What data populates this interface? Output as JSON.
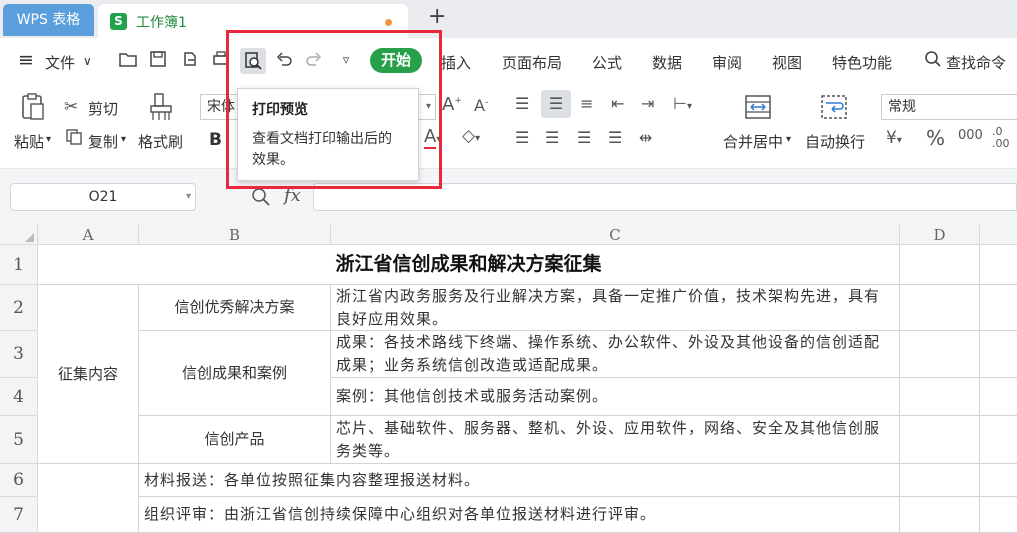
{
  "tabs": {
    "app": "WPS 表格",
    "doc_badge": "S",
    "doc": "工作簿1",
    "plus": "+"
  },
  "menu": {
    "hamburger": "≡",
    "file": "文件",
    "start": "开始",
    "items": [
      "插入",
      "页面布局",
      "公式",
      "数据",
      "审阅",
      "视图",
      "特色功能"
    ],
    "search": "查找命令"
  },
  "ribbon": {
    "paste": "粘贴",
    "cut": "剪切",
    "copy": "复制",
    "format_painter": "格式刷",
    "font": "宋体",
    "bold": "B",
    "merge": "合并居中",
    "wrap": "自动换行",
    "number_format": "常规"
  },
  "tooltip": {
    "title": "打印预览",
    "desc": "查看文档打印输出后的效果。"
  },
  "formula": {
    "cell_ref": "O21",
    "fx": "fx"
  },
  "grid": {
    "columns": [
      "A",
      "B",
      "C",
      "D"
    ],
    "rows": [
      "1",
      "2",
      "3",
      "4",
      "5",
      "6",
      "7"
    ],
    "title": "浙江省信创成果和解决方案征集",
    "a_merged": "征集内容",
    "b2": "信创优秀解决方案",
    "c2": "浙江省内政务服务及行业解决方案，具备一定推广价值，技术架构先进，具有良好应用效果。",
    "b34": "信创成果和案例",
    "c3": "成果：各技术路线下终端、操作系统、办公软件、外设及其他设备的信创适配成果；业务系统信创改造或适配成果。",
    "c4": "案例：其他信创技术或服务活动案例。",
    "b5": "信创产品",
    "c5": "芯片、基础软件、服务器、整机、外设、应用软件，网络、安全及其他信创服务类等。",
    "r6": "材料报送：各单位按照征集内容整理报送材料。",
    "r7": "组织评审：由浙江省信创持续保障中心组织对各单位报送材料进行评审。"
  }
}
